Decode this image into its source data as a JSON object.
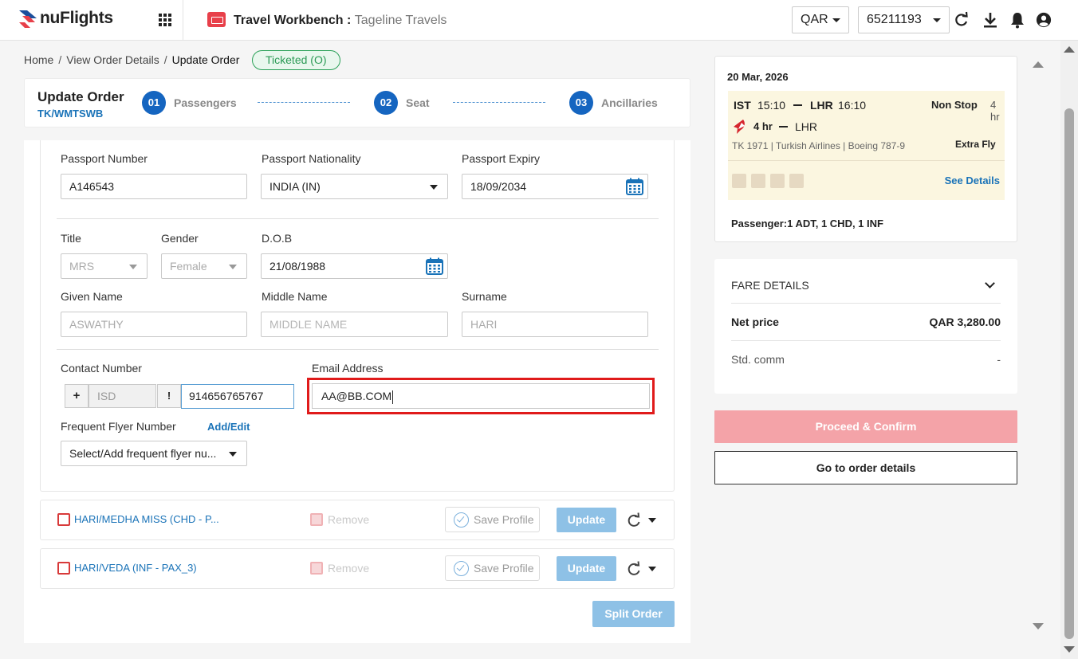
{
  "header": {
    "logo_text": "nuFlights",
    "app_title": "Travel Workbench :",
    "agency": "Tageline Travels",
    "currency": "QAR",
    "account": "65211193"
  },
  "breadcrumb": {
    "home": "Home",
    "view": "View Order Details",
    "current": "Update Order",
    "sep": "/"
  },
  "status_badge": "Ticketed (O)",
  "order": {
    "title": "Update Order",
    "code": "TK/WMTSWB",
    "steps": [
      {
        "num": "01",
        "label": "Passengers"
      },
      {
        "num": "02",
        "label": "Seat"
      },
      {
        "num": "03",
        "label": "Ancillaries"
      }
    ]
  },
  "form": {
    "passport_number_label": "Passport Number",
    "passport_number": "A146543",
    "passport_nationality_label": "Passport Nationality",
    "passport_nationality": "INDIA (IN)",
    "passport_expiry_label": "Passport Expiry",
    "passport_expiry": "18/09/2034",
    "title_label": "Title",
    "title_value": "MRS",
    "gender_label": "Gender",
    "gender_value": "Female",
    "dob_label": "D.O.B",
    "dob": "21/08/1988",
    "given_name_label": "Given Name",
    "given_name": "ASWATHY",
    "middle_name_label": "Middle Name",
    "middle_name_placeholder": "MIDDLE NAME",
    "surname_label": "Surname",
    "surname": "HARI",
    "contact_label": "Contact Number",
    "isd_plus": "+",
    "isd_placeholder": "ISD",
    "excl": "!",
    "phone": "914656765767",
    "email_label": "Email Address",
    "email": "AA@BB.COM",
    "ffn_label": "Frequent Flyer Number",
    "ffn_link": "Add/Edit",
    "ffn_select": "Select/Add frequent flyer nu..."
  },
  "passengers": [
    {
      "name": "HARI/MEDHA MISS (CHD - P...",
      "remove": "Remove",
      "save": "Save Profile",
      "update": "Update"
    },
    {
      "name": "HARI/VEDA (INF - PAX_3)",
      "remove": "Remove",
      "save": "Save Profile",
      "update": "Update"
    }
  ],
  "split_order": "Split Order",
  "flight": {
    "date": "20 Mar, 2026",
    "from": "IST",
    "dep_time": "15:10",
    "to": "LHR",
    "arr_time": "16:10",
    "stops": "Non Stop",
    "duration": "4 hr",
    "seg_duration": "4 hr",
    "seg_dest": "LHR",
    "flight_info": "TK 1971 | Turkish Airlines | Boeing 787-9",
    "fare_brand": "Extra Fly",
    "see_details": "See Details",
    "passengers": "Passenger:1 ADT, 1 CHD, 1 INF"
  },
  "fare": {
    "title": "FARE DETAILS",
    "net_label": "Net price",
    "net_value": "QAR 3,280.00",
    "comm_label": "Std. comm",
    "comm_value": "-"
  },
  "actions": {
    "proceed": "Proceed & Confirm",
    "goto": "Go to order details"
  },
  "colors": {
    "primary": "#1565c0",
    "link": "#1a73b8",
    "ticketed": "#2b9a55",
    "proceed_disabled": "#f4a3a8",
    "highlight": "#e01b1b"
  }
}
